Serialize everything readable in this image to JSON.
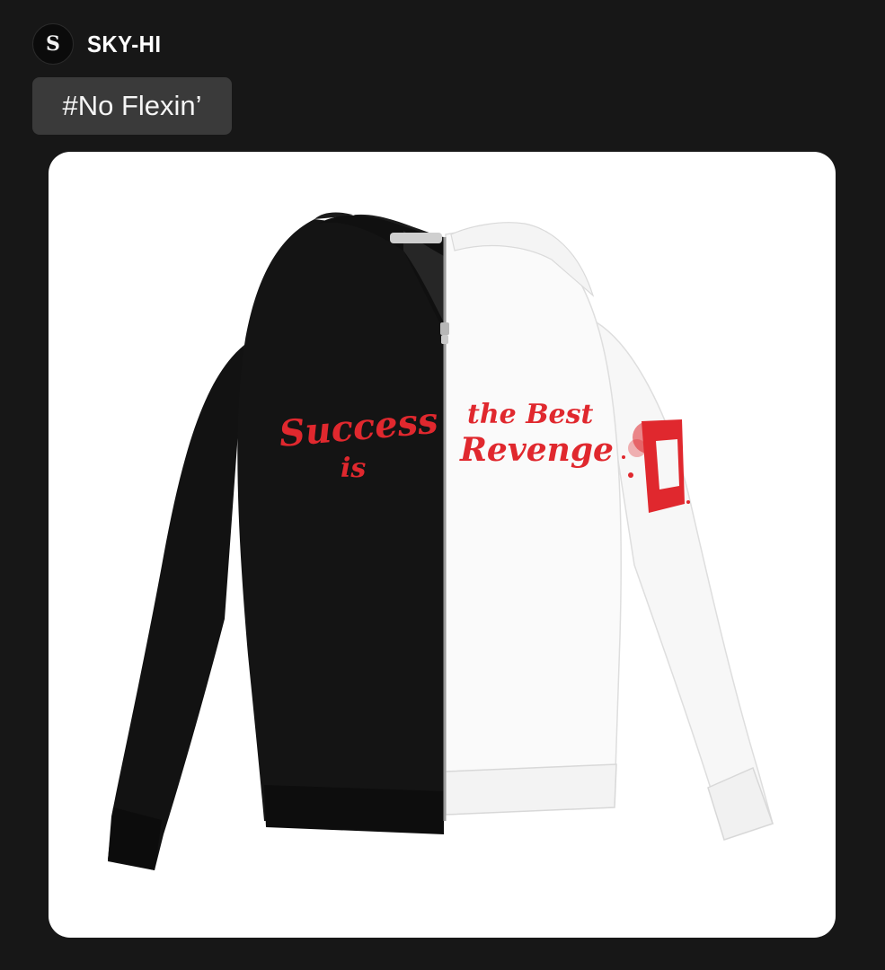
{
  "post": {
    "author": "SKY-HI",
    "avatar_glyph": "S",
    "tag": "#No Flexin’"
  },
  "image": {
    "print_left_1": "Success",
    "print_left_2": "is",
    "print_right_1": "the Best",
    "print_right_2": "Revenge",
    "colors": {
      "background": "#171717",
      "tag_bg": "#3a3a3a",
      "card_bg": "#ffffff",
      "print_red": "#e0282e"
    }
  }
}
